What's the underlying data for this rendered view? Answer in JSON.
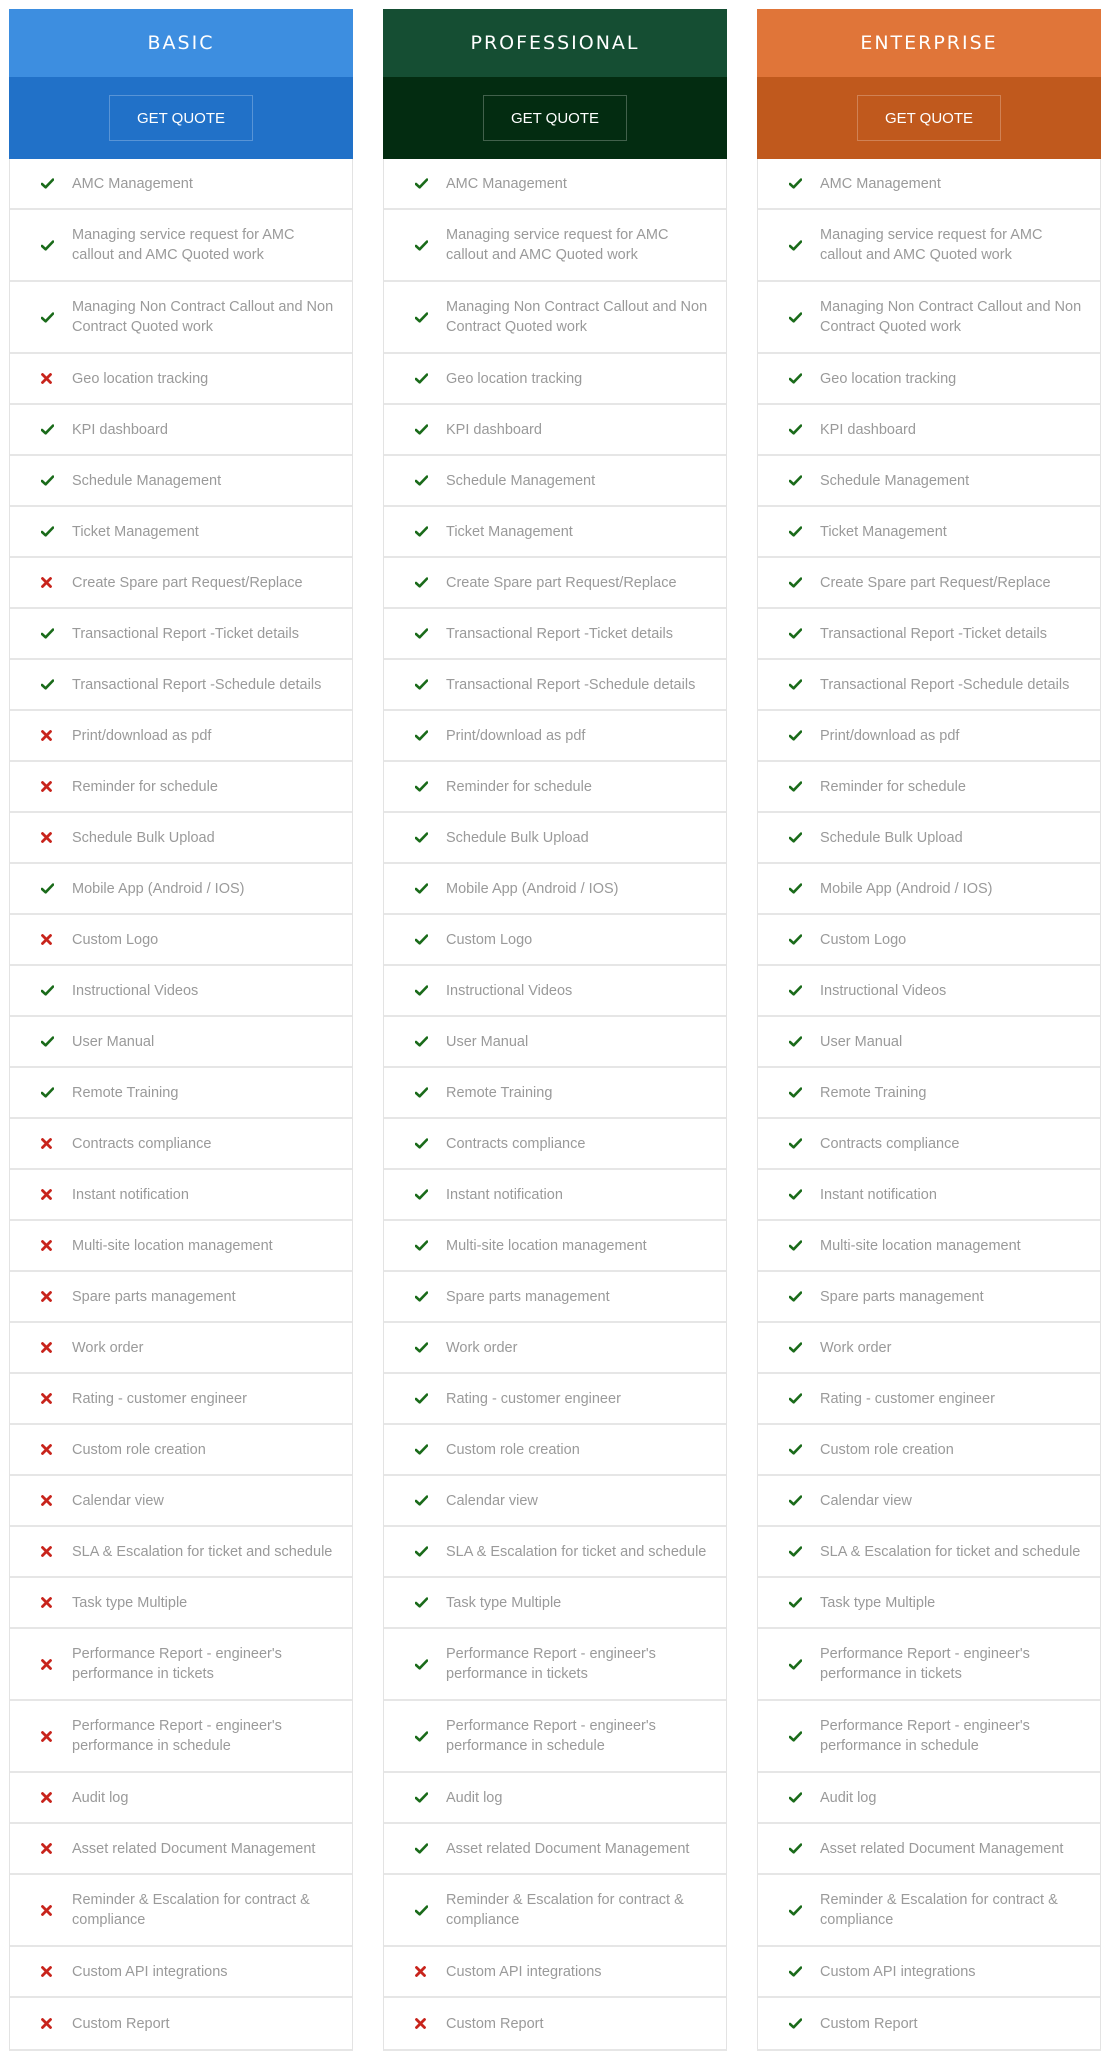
{
  "plans": [
    {
      "name": "BASIC",
      "cta_label": "GET QUOTE",
      "title_color": "#3d8ee0",
      "cta_band_color": "#2171c8"
    },
    {
      "name": "PROFESSIONAL",
      "cta_label": "GET QUOTE",
      "title_color": "#154e33",
      "cta_band_color": "#032c11"
    },
    {
      "name": "ENTERPRISE",
      "cta_label": "GET QUOTE",
      "title_color": "#e07539",
      "cta_band_color": "#c0591d"
    }
  ],
  "icons": {
    "included": {
      "semantic": "check-icon",
      "color": "#1a6b1a"
    },
    "excluded": {
      "semantic": "cross-icon",
      "color": "#c8241c"
    }
  },
  "features": [
    {
      "label": "AMC Management",
      "lines": 1,
      "included": [
        true,
        true,
        true
      ]
    },
    {
      "label": "Managing service request for AMC callout and AMC Quoted work",
      "lines": 2,
      "included": [
        true,
        true,
        true
      ]
    },
    {
      "label": "Managing Non Contract Callout and Non Contract Quoted work",
      "lines": 2,
      "included": [
        true,
        true,
        true
      ]
    },
    {
      "label": "Geo location tracking",
      "lines": 1,
      "included": [
        false,
        true,
        true
      ]
    },
    {
      "label": "KPI dashboard",
      "lines": 1,
      "included": [
        true,
        true,
        true
      ]
    },
    {
      "label": "Schedule Management",
      "lines": 1,
      "included": [
        true,
        true,
        true
      ]
    },
    {
      "label": "Ticket Management",
      "lines": 1,
      "included": [
        true,
        true,
        true
      ]
    },
    {
      "label": "Create Spare part Request/Replace",
      "lines": 1,
      "included": [
        false,
        true,
        true
      ]
    },
    {
      "label": "Transactional Report -Ticket details",
      "lines": 1,
      "included": [
        true,
        true,
        true
      ]
    },
    {
      "label": "Transactional Report -Schedule details",
      "lines": 1,
      "included": [
        true,
        true,
        true
      ]
    },
    {
      "label": "Print/download as pdf",
      "lines": 1,
      "included": [
        false,
        true,
        true
      ]
    },
    {
      "label": "Reminder for schedule",
      "lines": 1,
      "included": [
        false,
        true,
        true
      ]
    },
    {
      "label": "Schedule Bulk Upload",
      "lines": 1,
      "included": [
        false,
        true,
        true
      ]
    },
    {
      "label": "Mobile App (Android / IOS)",
      "lines": 1,
      "included": [
        true,
        true,
        true
      ]
    },
    {
      "label": "Custom Logo",
      "lines": 1,
      "included": [
        false,
        true,
        true
      ]
    },
    {
      "label": "Instructional Videos",
      "lines": 1,
      "included": [
        true,
        true,
        true
      ]
    },
    {
      "label": "User Manual",
      "lines": 1,
      "included": [
        true,
        true,
        true
      ]
    },
    {
      "label": "Remote Training",
      "lines": 1,
      "included": [
        true,
        true,
        true
      ]
    },
    {
      "label": "Contracts compliance",
      "lines": 1,
      "included": [
        false,
        true,
        true
      ]
    },
    {
      "label": "Instant notification",
      "lines": 1,
      "included": [
        false,
        true,
        true
      ]
    },
    {
      "label": "Multi-site location management",
      "lines": 1,
      "included": [
        false,
        true,
        true
      ]
    },
    {
      "label": "Spare parts management",
      "lines": 1,
      "included": [
        false,
        true,
        true
      ]
    },
    {
      "label": "Work order",
      "lines": 1,
      "included": [
        false,
        true,
        true
      ]
    },
    {
      "label": "Rating - customer engineer",
      "lines": 1,
      "included": [
        false,
        true,
        true
      ]
    },
    {
      "label": "Custom role creation",
      "lines": 1,
      "included": [
        false,
        true,
        true
      ]
    },
    {
      "label": "Calendar view",
      "lines": 1,
      "included": [
        false,
        true,
        true
      ]
    },
    {
      "label": "SLA & Escalation for ticket and schedule",
      "lines": 1,
      "included": [
        false,
        true,
        true
      ]
    },
    {
      "label": "Task type Multiple",
      "lines": 1,
      "included": [
        false,
        true,
        true
      ]
    },
    {
      "label": "Performance Report - engineer's performance in tickets",
      "lines": 2,
      "included": [
        false,
        true,
        true
      ]
    },
    {
      "label": "Performance Report - engineer's performance in schedule",
      "lines": 2,
      "included": [
        false,
        true,
        true
      ]
    },
    {
      "label": "Audit log",
      "lines": 1,
      "included": [
        false,
        true,
        true
      ]
    },
    {
      "label": "Asset related Document Management",
      "lines": 1,
      "included": [
        false,
        true,
        true
      ]
    },
    {
      "label": "Reminder & Escalation for contract & compliance",
      "lines": 2,
      "included": [
        false,
        true,
        true
      ]
    },
    {
      "label": "Custom API integrations",
      "lines": 1,
      "included": [
        false,
        false,
        true
      ]
    },
    {
      "label": "Custom Report",
      "lines": 1,
      "included": [
        false,
        false,
        true
      ]
    }
  ]
}
